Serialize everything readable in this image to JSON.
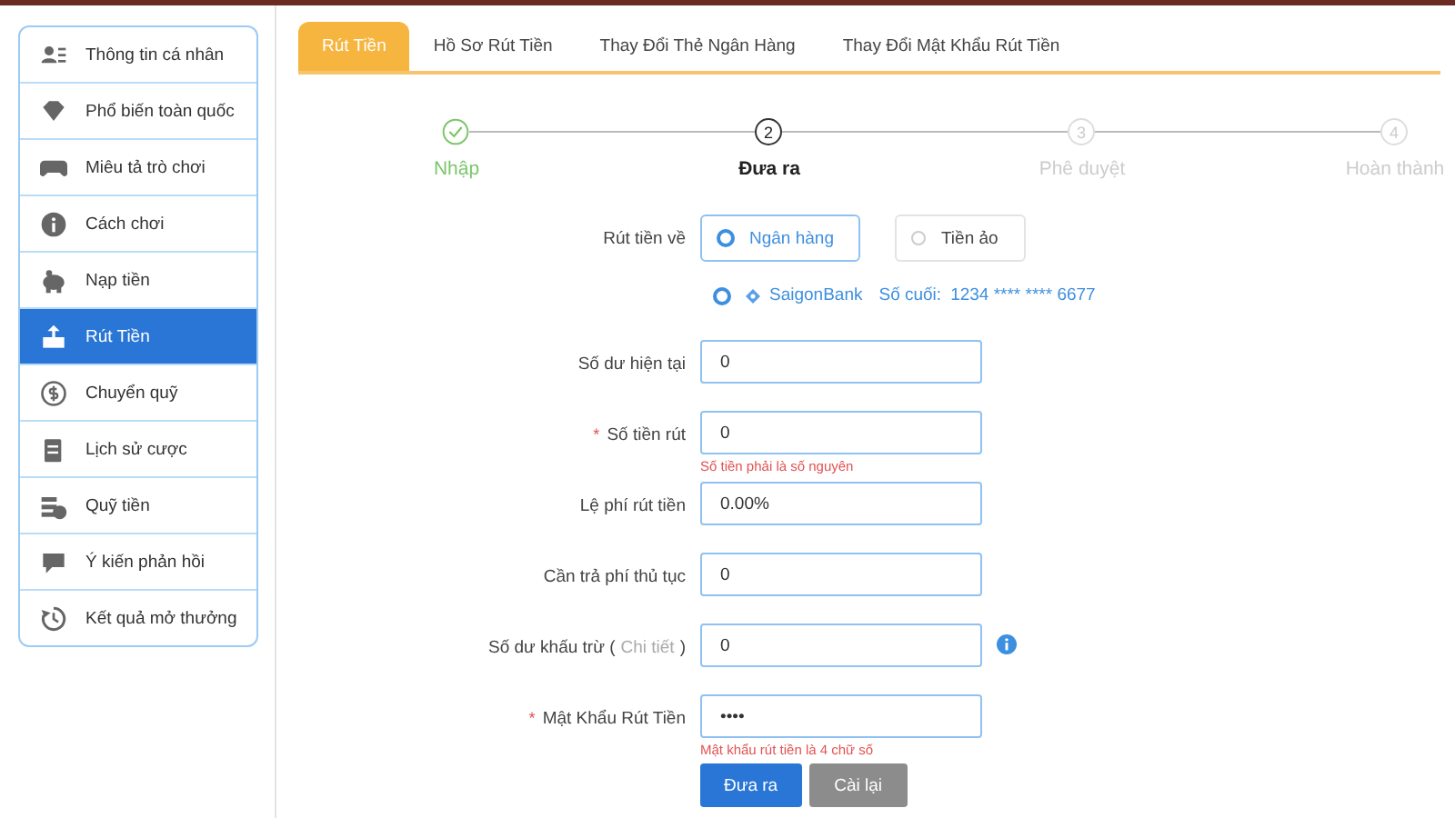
{
  "sidebar": {
    "items": [
      {
        "label": "Thông tin cá nhân",
        "selected": false
      },
      {
        "label": "Phổ biến toàn quốc",
        "selected": false
      },
      {
        "label": "Miêu tả trò chơi",
        "selected": false
      },
      {
        "label": "Cách chơi",
        "selected": false
      },
      {
        "label": "Nạp tiền",
        "selected": false
      },
      {
        "label": "Rút Tiền",
        "selected": true
      },
      {
        "label": "Chuyển quỹ",
        "selected": false
      },
      {
        "label": "Lịch sử cược",
        "selected": false
      },
      {
        "label": "Quỹ tiền",
        "selected": false
      },
      {
        "label": "Ý kiến phản hồi",
        "selected": false
      },
      {
        "label": "Kết quả mở thưởng",
        "selected": false
      }
    ]
  },
  "tabs": [
    {
      "label": "Rút Tiền",
      "selected": true
    },
    {
      "label": "Hồ Sơ Rút Tiền",
      "selected": false
    },
    {
      "label": "Thay Đổi Thẻ Ngân Hàng",
      "selected": false
    },
    {
      "label": "Thay Đổi Mật Khẩu Rút Tiền",
      "selected": false
    }
  ],
  "steps": [
    {
      "label": "Nhập",
      "completed": true,
      "selected": false
    },
    {
      "number": "2",
      "label": "Đưa ra",
      "completed": false,
      "selected": true
    },
    {
      "number": "3",
      "label": "Phê duyệt",
      "completed": false,
      "selected": false
    },
    {
      "number": "4",
      "label": "Hoàn thành",
      "completed": false,
      "selected": false
    }
  ],
  "destination": {
    "label": "Rút tiền về",
    "options": [
      {
        "label": "Ngân hàng",
        "selected": true
      },
      {
        "label": "Tiền ảo",
        "selected": false
      }
    ]
  },
  "bank_account": {
    "selected": true,
    "bank": "SaigonBank",
    "last_digits_label": "Số cuối:",
    "number": "1234 **** **** 6677"
  },
  "fields": [
    {
      "label": "Số dư hiện tại",
      "value": "0"
    },
    {
      "required_mark": "*",
      "label": "Số tiền rút",
      "value": "0",
      "error": "Số tiền phải là số nguyên"
    },
    {
      "label": "Lệ phí rút tiền",
      "value": "0.00%"
    },
    {
      "label": "Cần trả phí thủ tục",
      "value": "0"
    },
    {
      "label": "Số dư khấu trừ (",
      "link": "Chi tiết",
      "label_suffix": ")",
      "value": "0",
      "info": true
    },
    {
      "required_mark": "*",
      "label": "Mật Khẩu Rút Tiền",
      "value": "••••",
      "error": "Mật khẩu rút tiền là 4 chữ số"
    }
  ],
  "buttons": [
    {
      "label": "Đưa ra",
      "kind": "primary"
    },
    {
      "label": "Cài lại",
      "kind": "secondary"
    }
  ]
}
